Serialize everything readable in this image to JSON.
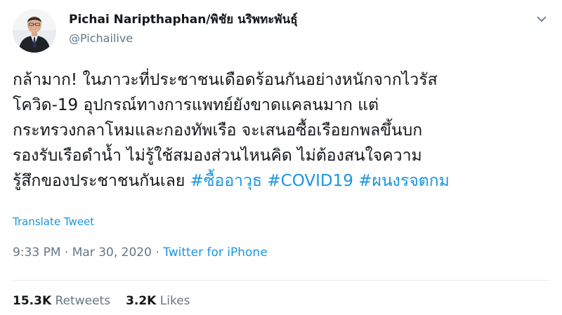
{
  "author": {
    "display_name": "Pichai Naripthaphan/พิชัย นริพทะพันธุ์",
    "handle": "@Pichailive"
  },
  "tweet": {
    "lines": [
      "กล้ามาก! ในภาวะที่ประชาชนเดือดร้อนกันอย่างหนักจากไวรัส",
      "โควิด-19 อุปกรณ์ทางการแพทย์ยังขาดแคลนมาก แต่",
      "กระทรวงกลาโหมและกองทัพเรือ จะเสนอซื้อเรือยกพลขึ้นบก",
      "รองรับเรือดำน้ำ ไม่รู้ใช้สมองส่วนไหนคิด ไม่ต้องสนใจความ"
    ],
    "last_line_text": "รู้สึกของประชาชนกันเลย",
    "hashtags": [
      "#ซื้ออาวุธ",
      "#COVID19",
      "#ผนงรจตกม"
    ]
  },
  "translate_label": "Translate Tweet",
  "meta": {
    "time": "9:33 PM",
    "separator": "·",
    "date": "Mar 30, 2020",
    "source": "Twitter for iPhone"
  },
  "stats": {
    "retweets_count": "15.3K",
    "retweets_label": "Retweets",
    "likes_count": "3.2K",
    "likes_label": "Likes"
  },
  "icons": {
    "menu": "chevron-down-icon"
  },
  "colors": {
    "link": "#1b95e0",
    "secondary_text": "#657786",
    "primary_text": "#14171a",
    "divider": "#e6ecf0"
  }
}
